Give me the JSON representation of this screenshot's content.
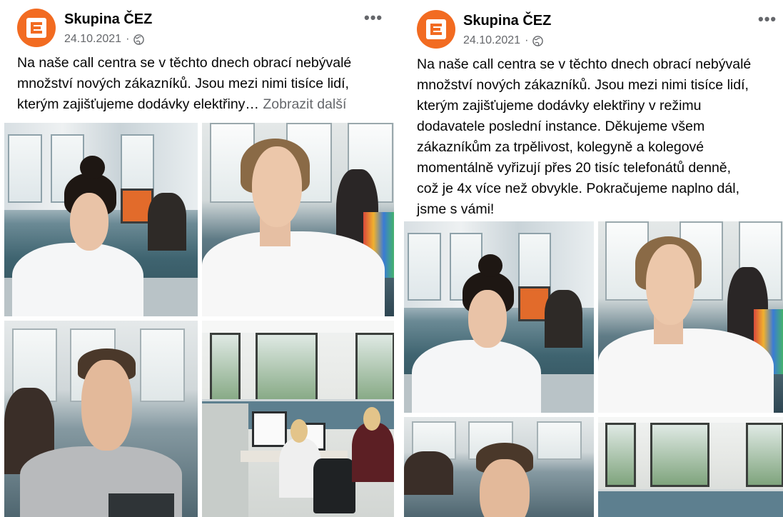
{
  "posts": [
    {
      "page_name": "Skupina ČEZ",
      "date": "24.10.2021",
      "separator": "·",
      "privacy_icon": "globe-icon",
      "more_icon": "more-horizontal-icon",
      "more_label": "•••",
      "caption_lines": [
        "Na naše call centra se v těchto dnech obrací nebývalé",
        "množství nových zákazníků. Jsou mezi nimi tisíce lidí,",
        "kterým zajišťujeme dodávky elektřiny…"
      ],
      "see_more": "Zobrazit další"
    },
    {
      "page_name": "Skupina ČEZ",
      "date": "24.10.2021",
      "separator": "·",
      "privacy_icon": "globe-icon",
      "more_icon": "more-horizontal-icon",
      "more_label": "•••",
      "caption_lines": [
        "Na naše call centra se v těchto dnech obrací nebývalé",
        "množství nových zákazníků. Jsou mezi nimi tisíce lidí,",
        "kterým zajišťujeme dodávky elektřiny v režimu",
        "dodavatele poslední instance. Děkujeme všem",
        "zákazníkům za trpělivost, kolegyně a kolegové",
        "momentálně vyřizují přes 20 tisíc telefonátů denně,",
        "což je 4x více než obvykle. Pokračujeme naplno dál,",
        "jsme s vámi!"
      ]
    }
  ],
  "colors": {
    "brand": "#f26b21",
    "muted_text": "#65676b",
    "text": "#050505"
  }
}
